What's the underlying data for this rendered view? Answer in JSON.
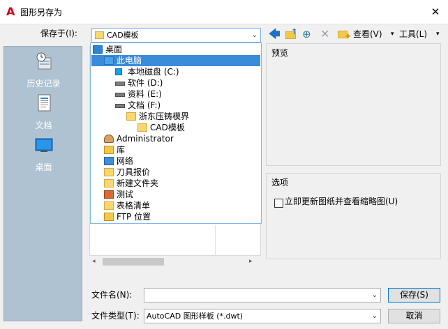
{
  "window": {
    "title": "图形另存为",
    "logo": "A",
    "close_glyph": "✕"
  },
  "save_in": {
    "label": "保存于(I):",
    "value": "CAD模板",
    "arrow": "⌄"
  },
  "toolbar": {
    "view_label": "查看(V)",
    "tools_label": "工具(L)",
    "caret": "▾",
    "icons": [
      "back-arrow-icon",
      "up-folder-icon",
      "search-web-icon",
      "delete-icon",
      "new-folder-icon"
    ]
  },
  "places": [
    {
      "label": "历史记录",
      "icon": "history-icon"
    },
    {
      "label": "文档",
      "icon": "documents-icon"
    },
    {
      "label": "桌面",
      "icon": "desktop-icon"
    }
  ],
  "dropdown": {
    "items": [
      {
        "label": "桌面",
        "icon": "desktop-icon"
      },
      {
        "label": "此电脑",
        "icon": "pc-icon",
        "selected": true
      },
      {
        "label": "本地磁盘 (C:)",
        "icon": "drive-c-icon"
      },
      {
        "label": "软件 (D:)",
        "icon": "drive-icon"
      },
      {
        "label": "资料 (E:)",
        "icon": "drive-icon"
      },
      {
        "label": "文档 (F:)",
        "icon": "drive-icon"
      },
      {
        "label": "浙东压铸模界",
        "icon": "folder-icon"
      },
      {
        "label": "CAD模板",
        "icon": "folder-icon"
      },
      {
        "label": "Administrator",
        "icon": "user-icon"
      },
      {
        "label": "库",
        "icon": "library-icon"
      },
      {
        "label": "网络",
        "icon": "network-icon"
      },
      {
        "label": "刀具报价",
        "icon": "folder-icon"
      },
      {
        "label": "新建文件夹",
        "icon": "folder-icon"
      },
      {
        "label": "测试",
        "icon": "ppt-icon"
      },
      {
        "label": "表格清单",
        "icon": "folder-icon"
      },
      {
        "label": "FTP 位置",
        "icon": "ftp-icon"
      }
    ]
  },
  "preview": {
    "label": "预览"
  },
  "options": {
    "label": "选项",
    "update_checkbox": "立即更新图纸并查看缩略图(U)",
    "checked": false
  },
  "scroll": {
    "left": "◂",
    "right": "▸"
  },
  "file_name": {
    "label": "文件名(N):",
    "value": ""
  },
  "file_type": {
    "label": "文件类型(T):",
    "value": "AutoCAD 图形样板 (*.dwt)"
  },
  "buttons": {
    "save": "保存(S)",
    "cancel": "取消"
  }
}
